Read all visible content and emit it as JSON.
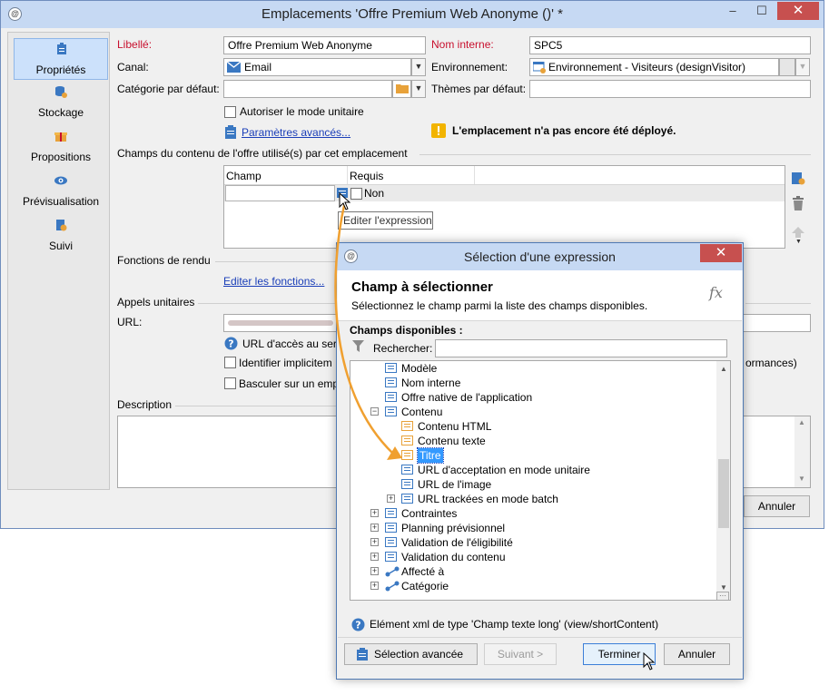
{
  "main_window": {
    "title": "Emplacements 'Offre Premium Web Anonyme ()' *",
    "minimize": "–",
    "maximize": "☐",
    "close": "✕",
    "app_icon": "app-logo-icon"
  },
  "sidebar": {
    "items": [
      {
        "label": "Propriétés",
        "icon": "properties-icon",
        "active": true
      },
      {
        "label": "Stockage",
        "icon": "storage-icon"
      },
      {
        "label": "Propositions",
        "icon": "gift-icon"
      },
      {
        "label": "Prévisualisation",
        "icon": "eye-icon"
      },
      {
        "label": "Suivi",
        "icon": "tracking-icon"
      }
    ]
  },
  "form": {
    "libelle_label": "Libellé:",
    "libelle_value": "Offre Premium Web Anonyme",
    "nom_interne_label": "Nom interne:",
    "nom_interne_value": "SPC5",
    "canal_label": "Canal:",
    "canal_value": "Email",
    "environnement_label": "Environnement:",
    "environnement_value": "Environnement - Visiteurs (designVisitor)",
    "categorie_label": "Catégorie par défaut:",
    "categorie_value": "",
    "themes_label": "Thèmes par défaut:",
    "themes_value": "",
    "unitaire_checkbox": "Autoriser le mode unitaire",
    "params_link": "Paramètres avancés...",
    "warning": "L'emplacement n'a pas encore été déployé.",
    "champs_section": "Champs du contenu de l'offre utilisé(s) par cet emplacement",
    "table_headers": [
      "Champ",
      "Requis"
    ],
    "table_row_requis": "Non",
    "tooltip": "Editer l'expression",
    "rendu_section": "Fonctions de rendu",
    "rendu_link": "Editer les fonctions...",
    "appels_section": "Appels unitaires",
    "url_label": "URL:",
    "url_access_partial": "URL d'accès au serv",
    "identifier_partial": "Identifier implicitem",
    "performances_partial": "ormances)",
    "basculer_partial": "Basculer sur un emp",
    "description_section": "Description",
    "annuler_button": "Annuler"
  },
  "dialog": {
    "title": "Sélection d'une expression",
    "close": "✕",
    "heading": "Champ à sélectionner",
    "subheading": "Sélectionnez le champ parmi la liste des champs disponibles.",
    "fx": "fx",
    "available_label": "Champs disponibles :",
    "search_label": "Rechercher:",
    "search_value": "",
    "tree": [
      {
        "label": "Modèle",
        "level": 1,
        "expander": "",
        "icon": "blue"
      },
      {
        "label": "Nom interne",
        "level": 1,
        "expander": "",
        "icon": "blue-key"
      },
      {
        "label": "Offre native de l'application",
        "level": 1,
        "expander": "",
        "icon": "blue"
      },
      {
        "label": "Contenu",
        "level": 1,
        "expander": "−",
        "icon": "blue"
      },
      {
        "label": "Contenu HTML",
        "level": 2,
        "expander": "",
        "icon": "orange"
      },
      {
        "label": "Contenu texte",
        "level": 2,
        "expander": "",
        "icon": "orange"
      },
      {
        "label": "Titre",
        "level": 2,
        "expander": "",
        "icon": "orange",
        "selected": true
      },
      {
        "label": "URL d'acceptation en mode unitaire",
        "level": 2,
        "expander": "",
        "icon": "blue"
      },
      {
        "label": "URL de l'image",
        "level": 2,
        "expander": "",
        "icon": "blue"
      },
      {
        "label": "URL trackées en mode batch",
        "level": 2,
        "expander": "+",
        "icon": "blue"
      },
      {
        "label": "Contraintes",
        "level": 1,
        "expander": "+",
        "icon": "blue"
      },
      {
        "label": "Planning prévisionnel",
        "level": 1,
        "expander": "+",
        "icon": "blue"
      },
      {
        "label": "Validation de l'éligibilité",
        "level": 1,
        "expander": "+",
        "icon": "blue"
      },
      {
        "label": "Validation du contenu",
        "level": 1,
        "expander": "+",
        "icon": "blue"
      },
      {
        "label": "Affecté à",
        "level": 1,
        "expander": "+",
        "icon": "link"
      },
      {
        "label": "Catégorie",
        "level": 1,
        "expander": "+",
        "icon": "link"
      }
    ],
    "status": "Elément xml de type 'Champ texte long' (view/shortContent)",
    "buttons": {
      "advanced": "Sélection avancée",
      "next": "Suivant >",
      "finish": "Terminer",
      "cancel": "Annuler"
    }
  },
  "colors": {
    "accent": "#3c7fd8",
    "link": "#1a3eb8",
    "required_label": "#c8102e",
    "arrow": "#f0a030",
    "close_button": "#c7504f"
  }
}
